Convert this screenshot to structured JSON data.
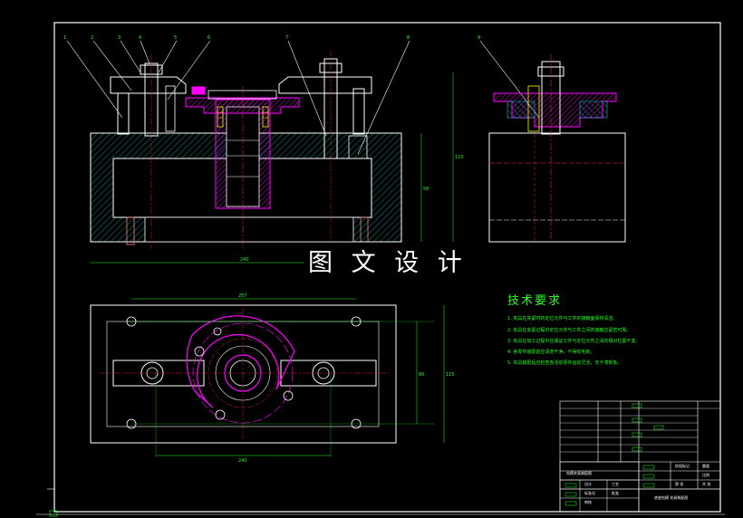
{
  "watermark": "图 文 设 计",
  "tech_title": "技术要求",
  "tech_notes": [
    "1.  夹具在夹紧时的定位元件与工件的接触面保持清洁。",
    "2.  夹具在夹紧过程中定位元件与工件之间的接触应紧密可靠。",
    "3.  夹具在加工过程中应保证工件与定位元件之间的相对位置不变。",
    "4.  各零件装配前应清洗干净，不得有毛刺。",
    "5.  夹具装配后应检查各活动零件运动灵活，无卡滞现象。"
  ],
  "part_labels": [
    "1",
    "2",
    "3",
    "4",
    "5",
    "6",
    "7",
    "8",
    "9"
  ],
  "dims": {
    "width_front": "240",
    "height_total": "110",
    "height_inner": "58",
    "top_width": "257",
    "bottom_width": "240",
    "side_height": "115",
    "side_inner": "80"
  },
  "title_block": {
    "drawing_name": "底座钻模 夹具装配图",
    "cells": [
      "标记",
      "处数",
      "分区",
      "更改文件号",
      "签名",
      "年月日",
      "设计",
      "标准化",
      "审核",
      "工艺",
      "批准",
      "阶段标记",
      "重量",
      "比例",
      "共 张",
      "第 张"
    ],
    "left_caption": "钻模夹具装配图"
  },
  "colors": {
    "background": "#000000",
    "outline": "#ffffff",
    "hatch": "#00c8c8",
    "part": "#ff00ff",
    "dimension": "#22ff22",
    "thread": "#ffff00",
    "center": "#ff3333"
  }
}
